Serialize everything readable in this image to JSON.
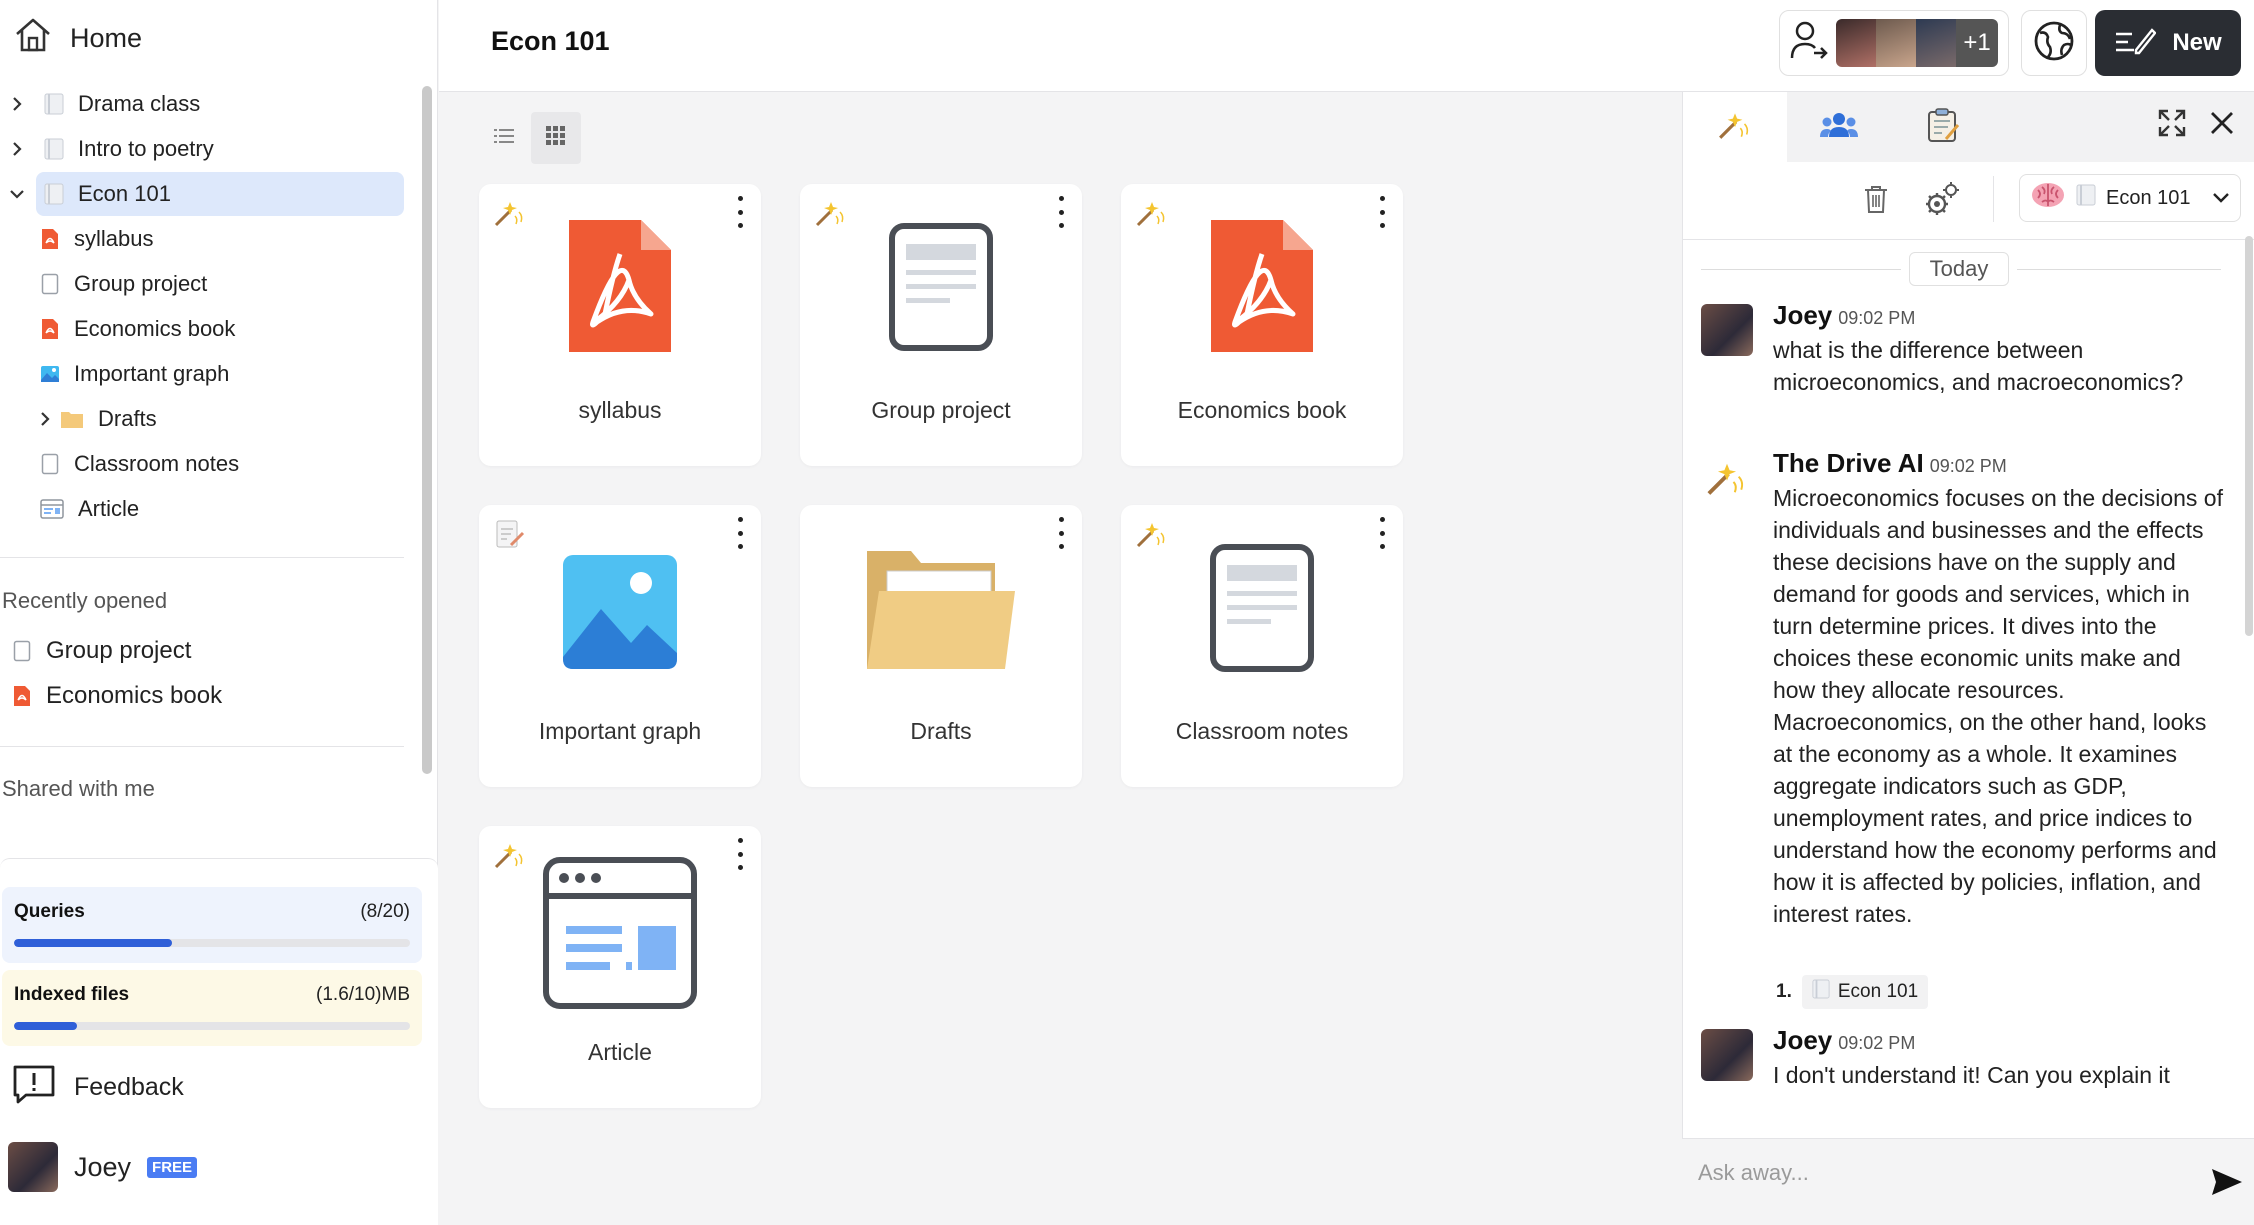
{
  "sidebar": {
    "home_label": "Home",
    "tree": [
      {
        "label": "Drama class",
        "icon": "notebook-icon",
        "expandable": true
      },
      {
        "label": "Intro to poetry",
        "icon": "notebook-icon",
        "expandable": true
      },
      {
        "label": "Econ 101",
        "icon": "notebook-icon",
        "expandable": true,
        "expanded": true,
        "selected": true
      },
      {
        "label": "syllabus",
        "icon": "pdf-icon"
      },
      {
        "label": "Group project",
        "icon": "doc-icon"
      },
      {
        "label": "Economics book",
        "icon": "pdf-icon"
      },
      {
        "label": "Important graph",
        "icon": "image-icon"
      },
      {
        "label": "Drafts",
        "icon": "folder-icon",
        "expandable": true
      },
      {
        "label": "Classroom notes",
        "icon": "doc-icon"
      },
      {
        "label": "Article",
        "icon": "web-article-icon"
      }
    ],
    "recent_title": "Recently opened",
    "recent": [
      {
        "label": "Group project",
        "icon": "doc-icon"
      },
      {
        "label": "Economics book",
        "icon": "pdf-icon"
      }
    ],
    "shared_title": "Shared with me"
  },
  "usage": {
    "queries_label": "Queries",
    "queries_count": "(8/20)",
    "queries_fraction": 0.4,
    "indexed_label": "Indexed files",
    "indexed_count": "(1.6/10)MB",
    "indexed_fraction": 0.16
  },
  "feedback_label": "Feedback",
  "user": {
    "name": "Joey",
    "plan_badge": "FREE"
  },
  "header": {
    "title": "Econ 101",
    "collaborators_extra": "+1",
    "new_label": "New"
  },
  "files": [
    {
      "label": "syllabus",
      "type": "pdf"
    },
    {
      "label": "Group project",
      "type": "doc"
    },
    {
      "label": "Economics book",
      "type": "pdf"
    },
    {
      "label": "Important graph",
      "type": "image"
    },
    {
      "label": "Drafts",
      "type": "folder"
    },
    {
      "label": "Classroom notes",
      "type": "doc"
    },
    {
      "label": "Article",
      "type": "article"
    }
  ],
  "chat": {
    "scope_label": "Econ 101",
    "date_divider": "Today",
    "messages": [
      {
        "author": "Joey",
        "time": "09:02 PM",
        "text": "what is the difference between microeconomics, and macroeconomics?"
      },
      {
        "author": "The Drive AI",
        "time": "09:02 PM",
        "text": "Microeconomics focuses on the decisions of individuals and businesses and the effects these decisions have on the supply and demand for goods and services, which in turn determine prices. It dives into the choices these economic units make and how they allocate resources. Macroeconomics, on the other hand, looks at the economy as a whole. It examines aggregate indicators such as GDP, unemployment rates, and price indices to understand how the economy performs and how it is affected by policies, inflation, and interest rates."
      },
      {
        "author": "Joey",
        "time": "09:02 PM",
        "text": "I don't understand it! Can you explain it"
      }
    ],
    "source_index": "1.",
    "source_label": "Econ 101",
    "input_placeholder": "Ask away..."
  },
  "colors": {
    "accent": "#2f5fd8",
    "pdf": "#ef5a34",
    "selected_bg": "#dde8fb",
    "new_button": "#2a2d33"
  }
}
